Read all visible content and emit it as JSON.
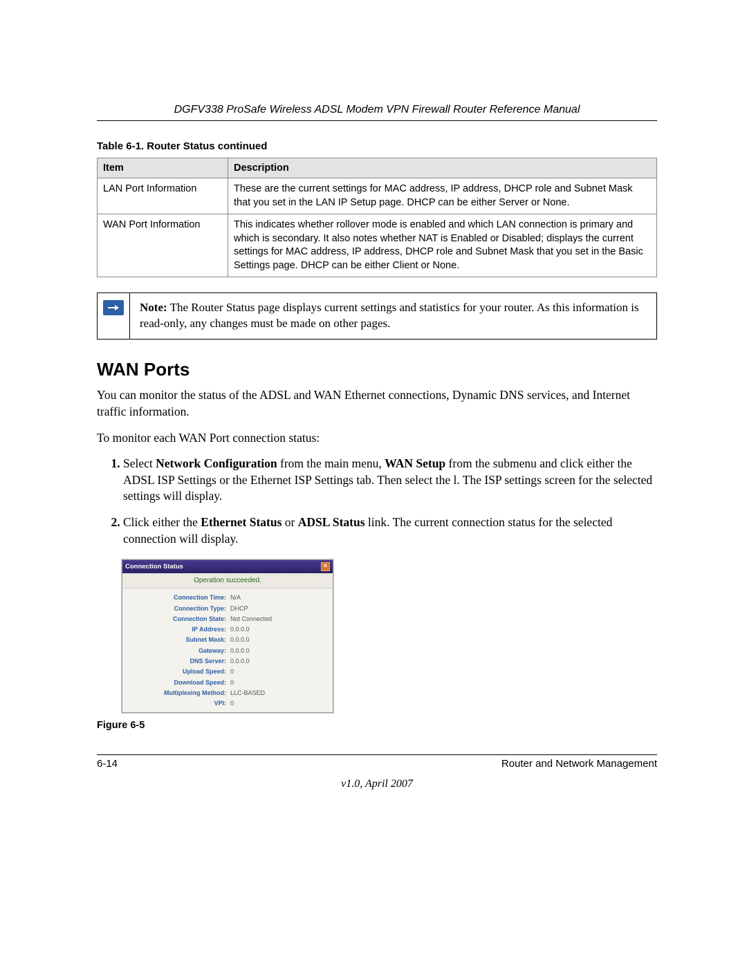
{
  "header": {
    "title": "DGFV338 ProSafe Wireless ADSL Modem VPN Firewall Router Reference Manual"
  },
  "table": {
    "caption": "Table 6-1.  Router Status  continued",
    "columns": [
      "Item",
      "Description"
    ],
    "rows": [
      {
        "item": "LAN Port Information",
        "desc": "These are the current settings for MAC address, IP address, DHCP role and Subnet Mask that you set in the LAN IP Setup page. DHCP can be either Server or None."
      },
      {
        "item": "WAN Port Information",
        "desc": "This indicates whether rollover mode is enabled and which LAN connection is primary and which is secondary. It also notes whether NAT is Enabled or Disabled; displays the current settings for MAC address, IP address, DHCP role and Subnet Mask that you set in the Basic Settings page. DHCP can be either Client or None."
      }
    ]
  },
  "note": {
    "label": "Note:",
    "text": "The Router Status page displays current settings and statistics for your router. As this information is read-only, any changes must be made on other pages."
  },
  "section": {
    "heading": "WAN Ports",
    "para1": "You can monitor the status of the ADSL and WAN Ethernet connections, Dynamic DNS services, and Internet traffic information.",
    "para2": "To monitor each WAN Port connection status:",
    "steps": [
      {
        "pre": "Select ",
        "b1": "Network Configuration",
        "mid": " from the main menu, ",
        "b2": "WAN Setup",
        "post": " from the submenu and click either the ADSL ISP Settings or the Ethernet ISP Settings tab. Then select the l. The ISP settings screen for the selected settings will display."
      },
      {
        "pre": "Click either the ",
        "b1": "Ethernet Status",
        "mid": " or ",
        "b2": "ADSL Status",
        "post": " link. The current connection status for the selected connection will display."
      }
    ]
  },
  "conn": {
    "title": "Connection Status",
    "status": "Operation succeeded.",
    "rows": [
      {
        "label": "Connection Time:",
        "value": "N/A"
      },
      {
        "label": "Connection Type:",
        "value": "DHCP"
      },
      {
        "label": "Connection State:",
        "value": "Not Connected"
      },
      {
        "label": "IP Address:",
        "value": "0.0.0.0"
      },
      {
        "label": "Subnet Mask:",
        "value": "0.0.0.0"
      },
      {
        "label": "Gateway:",
        "value": "0.0.0.0"
      },
      {
        "label": "DNS Server:",
        "value": "0.0.0.0"
      },
      {
        "label": "Upload Speed:",
        "value": "0"
      },
      {
        "label": "Download Speed:",
        "value": "0"
      },
      {
        "label": "Multiplexing Method:",
        "value": "LLC-BASED"
      },
      {
        "label": "VPI:",
        "value": "0"
      }
    ]
  },
  "figure": {
    "caption": "Figure 6-5"
  },
  "footer": {
    "page": "6-14",
    "chapter": "Router and Network Management",
    "version": "v1.0, April 2007"
  }
}
